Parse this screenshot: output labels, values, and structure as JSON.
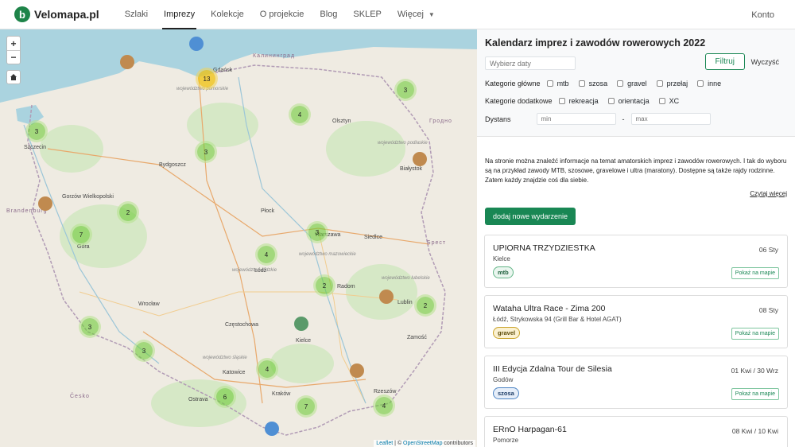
{
  "nav": {
    "logo_glyph": "b",
    "brand": "Velomapa.pl",
    "items": [
      {
        "label": "Szlaki",
        "active": false
      },
      {
        "label": "Imprezy",
        "active": true
      },
      {
        "label": "Kolekcje",
        "active": false
      },
      {
        "label": "O projekcie",
        "active": false
      },
      {
        "label": "Blog",
        "active": false
      },
      {
        "label": "SKLEP",
        "active": false
      },
      {
        "label": "Więcej",
        "active": false
      }
    ],
    "account": "Konto",
    "more_icon": "chevron-down-icon"
  },
  "map": {
    "zoom_in": "+",
    "zoom_out": "−",
    "home_icon": "home-icon",
    "attribution_leaflet": "Leaflet",
    "attribution_sep": " | © ",
    "attribution_osm": "OpenStreetMap",
    "attribution_rest": " contributors",
    "labels": {
      "gdansk": "Gdańsk",
      "kaliningrad": "Калининград",
      "szczecin": "Szczecin",
      "bydgoszcz": "Bydgoszcz",
      "grodno": "Гродно",
      "bialystok": "Białystok",
      "gorzow": "Gorzów Wielkopolski",
      "brandenburg": "Brandenburg",
      "plock": "Płock",
      "warszawa": "Warszawa",
      "brest": "Брест",
      "lodz": "Łódź",
      "radom": "Radom",
      "wroclaw": "Wrocław",
      "czestochowa": "Częstochowa",
      "kielce": "Kielce",
      "lublin": "Lublin",
      "katowice": "Katowice",
      "krakow": "Kraków",
      "rzeszow": "Rzeszów",
      "cesko": "Česko",
      "ostrava": "Ostrava",
      "gora": "Góra",
      "siedlce": "Siedlce",
      "zamosc": "Zamość",
      "olsztyn": "Olsztyn",
      "pomorskie": "województwo pomorskie",
      "mazowieckie": "województwo mazowieckie",
      "lodzkie": "województwo łódzkie",
      "slaskie": "województwo śląskie",
      "lubelskie": "województwo lubelskie",
      "podlaskie": "województwo podlaskie"
    },
    "clusters": [
      {
        "id": "c1",
        "count": "3",
        "type": "green"
      },
      {
        "id": "c2",
        "count": "13",
        "type": "yellow"
      },
      {
        "id": "c3",
        "count": "4",
        "type": "green"
      },
      {
        "id": "c4",
        "count": "3",
        "type": "green"
      },
      {
        "id": "c5",
        "count": "3",
        "type": "green"
      },
      {
        "id": "c6",
        "count": "2",
        "type": "green"
      },
      {
        "id": "c7",
        "count": "7",
        "type": "green"
      },
      {
        "id": "c8",
        "count": "3",
        "type": "green"
      },
      {
        "id": "c9",
        "count": "4",
        "type": "green"
      },
      {
        "id": "c10",
        "count": "2",
        "type": "green"
      },
      {
        "id": "c11",
        "count": "2",
        "type": "green"
      },
      {
        "id": "c12",
        "count": "3",
        "type": "green"
      },
      {
        "id": "c13",
        "count": "3",
        "type": "green"
      },
      {
        "id": "c14",
        "count": "4",
        "type": "green"
      },
      {
        "id": "c15",
        "count": "6",
        "type": "green"
      },
      {
        "id": "c16",
        "count": "7",
        "type": "green"
      },
      {
        "id": "c17",
        "count": "4",
        "type": "green"
      }
    ]
  },
  "panel": {
    "title": "Kalendarz imprez i zawodów rowerowych 2022",
    "date_placeholder": "Wybierz daty",
    "filter_button": "Filtruj",
    "clear_button": "Wyczyść",
    "main_categories_label": "Kategorie główne",
    "main_categories": [
      "mtb",
      "szosa",
      "gravel",
      "przełaj",
      "inne"
    ],
    "extra_categories_label": "Kategorie dodatkowe",
    "extra_categories": [
      "rekreacja",
      "orientacja",
      "XC"
    ],
    "distance_label": "Dystans",
    "distance_min_placeholder": "min",
    "distance_dash": "-",
    "distance_max_placeholder": "max",
    "intro": "Na stronie można znaleźć informacje na temat amatorskich imprez i zawodów rowerowych. I tak do wyboru są na przykład zawody MTB, szosowe, gravelowe i ultra (maratony). Dostępne są także rajdy rodzinne. Zatem każdy znajdzie coś dla siebie.",
    "read_more": "Czytaj więcej",
    "add_event": "dodaj nowe wydarzenie",
    "show_on_map": "Pokaż na mapie",
    "events": [
      {
        "title": "UPIORNA TRZYDZIESTKA",
        "date": "06 Sty",
        "place": "Kielce",
        "category": "mtb"
      },
      {
        "title": "Wataha Ultra Race - Zima 200",
        "date": "08 Sty",
        "place": "Łódź, Strykowska 94 (Grill Bar & Hotel AGAT)",
        "category": "gravel"
      },
      {
        "title": "III Edycja Zdalna Tour de Silesia",
        "date": "01 Kwi / 30 Wrz",
        "place": "Godów",
        "category": "szosa"
      },
      {
        "title": "ERnO Harpagan-61",
        "date": "08 Kwi / 10 Kwi",
        "place": "Pomorze",
        "category": ""
      }
    ]
  },
  "colors": {
    "accent": "#198754",
    "sea": "#aad3df",
    "land": "#efebe2",
    "forest": "#cde6b8"
  }
}
